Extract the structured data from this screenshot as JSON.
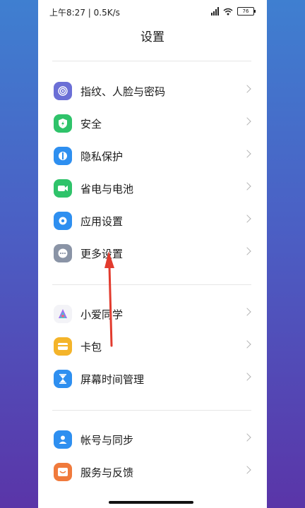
{
  "status_bar": {
    "time_speed": "上午8:27 | 0.5K/s",
    "battery": "76"
  },
  "page_title": "设置",
  "groups": [
    {
      "items": [
        {
          "label": "指纹、人脸与密码",
          "icon": "fingerprint-icon",
          "color": "#6b6fd6"
        },
        {
          "label": "安全",
          "icon": "shield-icon",
          "color": "#2fc36a"
        },
        {
          "label": "隐私保护",
          "icon": "privacy-icon",
          "color": "#2e8ff0"
        },
        {
          "label": "省电与电池",
          "icon": "battery-icon",
          "color": "#2fc36a"
        },
        {
          "label": "应用设置",
          "icon": "gear-icon",
          "color": "#2e8ff0"
        },
        {
          "label": "更多设置",
          "icon": "more-icon",
          "color": "#8a94a6"
        }
      ]
    },
    {
      "items": [
        {
          "label": "小爱同学",
          "icon": "xiaoai-icon",
          "color": "#ffffff"
        },
        {
          "label": "卡包",
          "icon": "wallet-icon",
          "color": "#f4b42a"
        },
        {
          "label": "屏幕时间管理",
          "icon": "hourglass-icon",
          "color": "#2e8ff0"
        }
      ]
    },
    {
      "items": [
        {
          "label": "帐号与同步",
          "icon": "account-icon",
          "color": "#2e8ff0"
        },
        {
          "label": "服务与反馈",
          "icon": "feedback-icon",
          "color": "#f07a3c"
        }
      ]
    }
  ],
  "colors": {
    "annotation_arrow": "#e23b2e"
  }
}
